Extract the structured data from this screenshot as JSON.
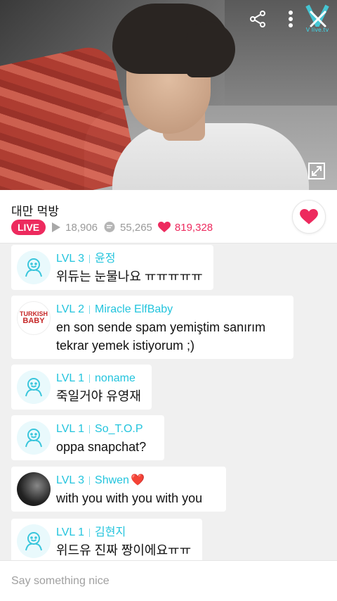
{
  "video": {
    "logo_text": "V live.tv"
  },
  "info": {
    "title": "대만 먹방",
    "live_label": "LIVE",
    "views": "18,906",
    "comments": "55,265",
    "hearts": "819,328"
  },
  "colors": {
    "accent": "#ed2a5e",
    "level_text": "#23c4dd"
  },
  "chat": {
    "messages": [
      {
        "level": "LVL 3",
        "user": "윤정",
        "text": "위듀는 눈물나요 ㅠㅠㅠㅠㅠ",
        "avatar": "default-avatar-icon"
      },
      {
        "level": "LVL 2",
        "user": "Miracle ElfBaby",
        "text": "en son sende spam yemiştim sanırım",
        "text2": "tekrar yemek istiyorum ;)",
        "avatar": "turkish-baby-avatar",
        "avatar_text": "TURKISH",
        "avatar_text2": "BABY"
      },
      {
        "level": "LVL 1",
        "user": "noname",
        "text": "죽일거야 유영재",
        "avatar": "default-avatar-icon"
      },
      {
        "level": "LVL 1",
        "user": "So_T.O.P",
        "text": "oppa snapchat?",
        "avatar": "default-avatar-icon"
      },
      {
        "level": "LVL 3",
        "user": "Shwen",
        "user_suffix": "❤️",
        "text": "with you with you with you",
        "avatar": "photo-avatar"
      },
      {
        "level": "LVL 1",
        "user": "김현지",
        "text": "위드유 진짜 짱이에요ㅠㅠ",
        "avatar": "default-avatar-icon"
      }
    ]
  },
  "composer": {
    "placeholder": "Say something nice"
  }
}
